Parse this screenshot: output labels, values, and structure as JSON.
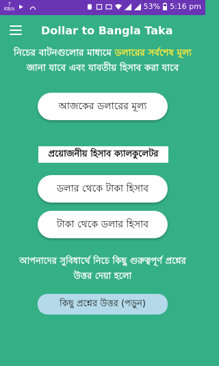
{
  "status_bar": {
    "speed_top": "7",
    "speed_bottom": "KB/s",
    "battery": "53%",
    "time": "5:16 pm"
  },
  "app_bar": {
    "title": "Dollar to Bangla Taka"
  },
  "intro": {
    "part1": "নিচের বাটনগুলোর মাধ্যমে ",
    "highlight": "ডলারের সর্বশেষ মূল্য",
    "part2": " জানা যাবে এবং যাবতীয় হিসাব করা যাবে"
  },
  "buttons": {
    "todays_rate": "আজকের ডলারের মূল্য",
    "dollar_to_taka": "ডলার থেকে টাকা হিসাব",
    "taka_to_dollar": "টাকা থেকে ডলার হিসাব",
    "questions": "কিছু প্রশ্নের উত্তর (পড়ুন)"
  },
  "calculator_label": "প্রয়োজনীয় হিসাব ক্যালকুলেটর",
  "note": "আপনাদের সুবিধার্থে নিচে কিছু গুরুত্বপূর্ণ প্রশ্নের উত্তর দেয়া হলো"
}
